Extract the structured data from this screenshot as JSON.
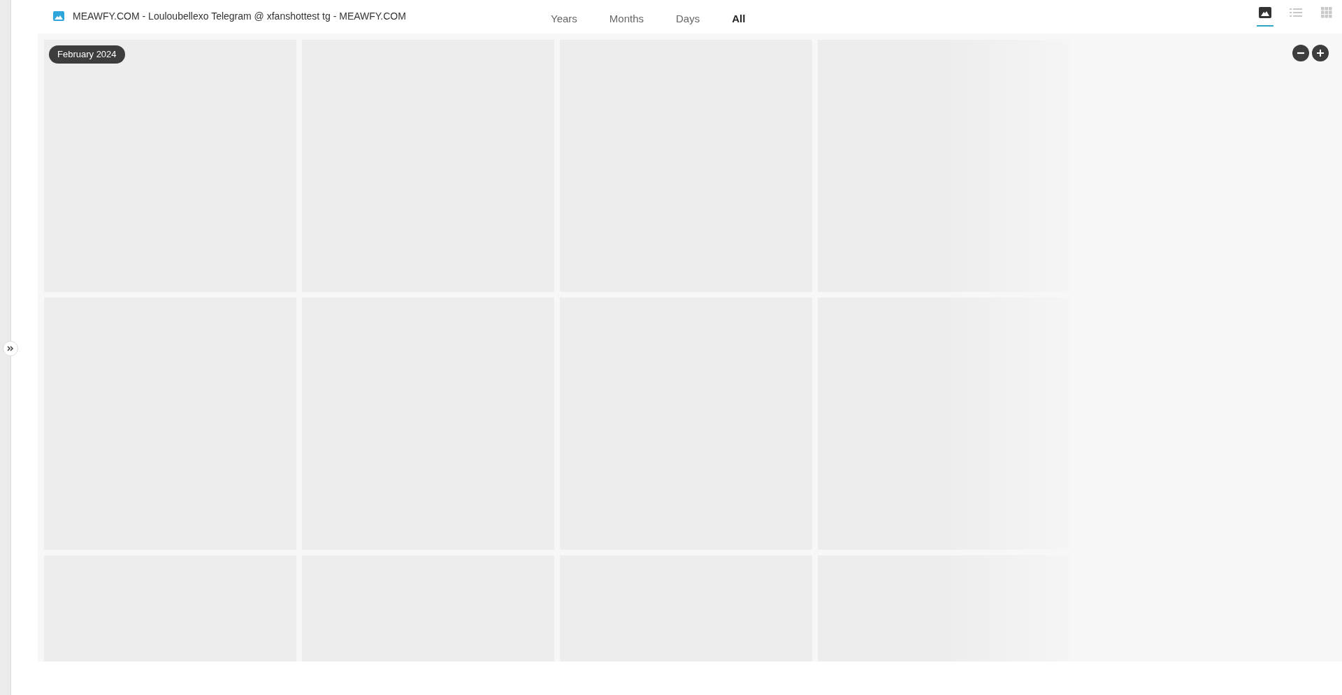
{
  "title": "MEAWFY.COM - Louloubellexo Telegram @ xfanshottest tg - MEAWFY.COM",
  "tabs": [
    {
      "label": "Years",
      "selected": false
    },
    {
      "label": "Months",
      "selected": false
    },
    {
      "label": "Days",
      "selected": false
    },
    {
      "label": "All",
      "selected": true
    }
  ],
  "view_modes": [
    {
      "kind": "photos",
      "selected": true
    },
    {
      "kind": "list",
      "selected": false
    },
    {
      "kind": "grid",
      "selected": false
    }
  ],
  "date_badge": "February 2024"
}
